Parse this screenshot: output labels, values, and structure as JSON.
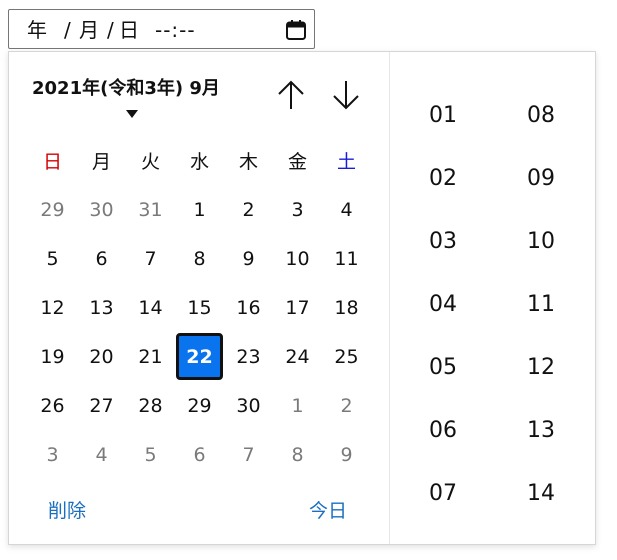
{
  "input": {
    "year_placeholder": "年",
    "month_placeholder": "月",
    "day_placeholder": "日",
    "separator": "/",
    "time_placeholder": "--:--",
    "calendar_icon": "calendar-icon"
  },
  "popup": {
    "month_title": "2021年(令和3年) 9月",
    "nav_up_icon": "arrow-up-icon",
    "nav_down_icon": "arrow-down-icon",
    "weekdays": [
      "日",
      "月",
      "火",
      "水",
      "木",
      "金",
      "土"
    ],
    "weeks": [
      [
        "29",
        "30",
        "31",
        "1",
        "2",
        "3",
        "4"
      ],
      [
        "5",
        "6",
        "7",
        "8",
        "9",
        "10",
        "11"
      ],
      [
        "12",
        "13",
        "14",
        "15",
        "16",
        "17",
        "18"
      ],
      [
        "19",
        "20",
        "21",
        "22",
        "23",
        "24",
        "25"
      ],
      [
        "26",
        "27",
        "28",
        "29",
        "30",
        "1",
        "2"
      ],
      [
        "3",
        "4",
        "5",
        "6",
        "7",
        "8",
        "9"
      ]
    ],
    "selected_day": "22",
    "clear_label": "削除",
    "today_label": "今日",
    "hours": [
      "01",
      "02",
      "03",
      "04",
      "05",
      "06",
      "07"
    ],
    "minutes": [
      "08",
      "09",
      "10",
      "11",
      "12",
      "13",
      "14"
    ],
    "colors": {
      "sunday": "#d40000",
      "saturday": "#1a1adb",
      "selected_bg": "#0a74ee",
      "link": "#1a6fbf"
    }
  }
}
